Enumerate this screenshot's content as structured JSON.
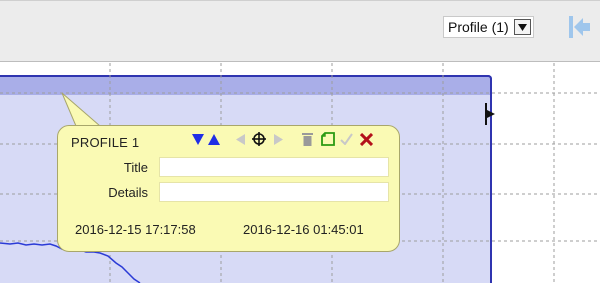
{
  "toolbar": {
    "profile_select": {
      "selected": "Profile (1)",
      "button_glyph": "▼"
    },
    "collapse_icon": "collapse-left-icon"
  },
  "chart": {
    "selection_color": "#d7daf6",
    "selection_border_color": "#2f34b0",
    "trace_color": "#2b3bd6"
  },
  "popup": {
    "title": "PROFILE 1",
    "tools": [
      {
        "icon": "move-down-icon",
        "color": "#1f2ee6"
      },
      {
        "icon": "move-up-icon",
        "color": "#1f2ee6"
      },
      {
        "icon": "previous-icon",
        "color": "#c8c8c8"
      },
      {
        "icon": "crosshair-icon",
        "color": "#111111"
      },
      {
        "icon": "next-icon",
        "color": "#c8c8c8"
      },
      {
        "icon": "trash-icon",
        "color": "#9a9a9a"
      },
      {
        "icon": "copy-icon",
        "color": "#2a9a12"
      },
      {
        "icon": "check-icon",
        "color": "#c8c8c8"
      },
      {
        "icon": "close-icon",
        "color": "#b3121b"
      }
    ],
    "title_field": {
      "label": "Title",
      "value": ""
    },
    "details_field": {
      "label": "Details",
      "value": ""
    },
    "start_time": "2016-12-15 17:17:58",
    "end_time": "2016-12-16 01:45:01",
    "background_color": "#fafab4"
  }
}
